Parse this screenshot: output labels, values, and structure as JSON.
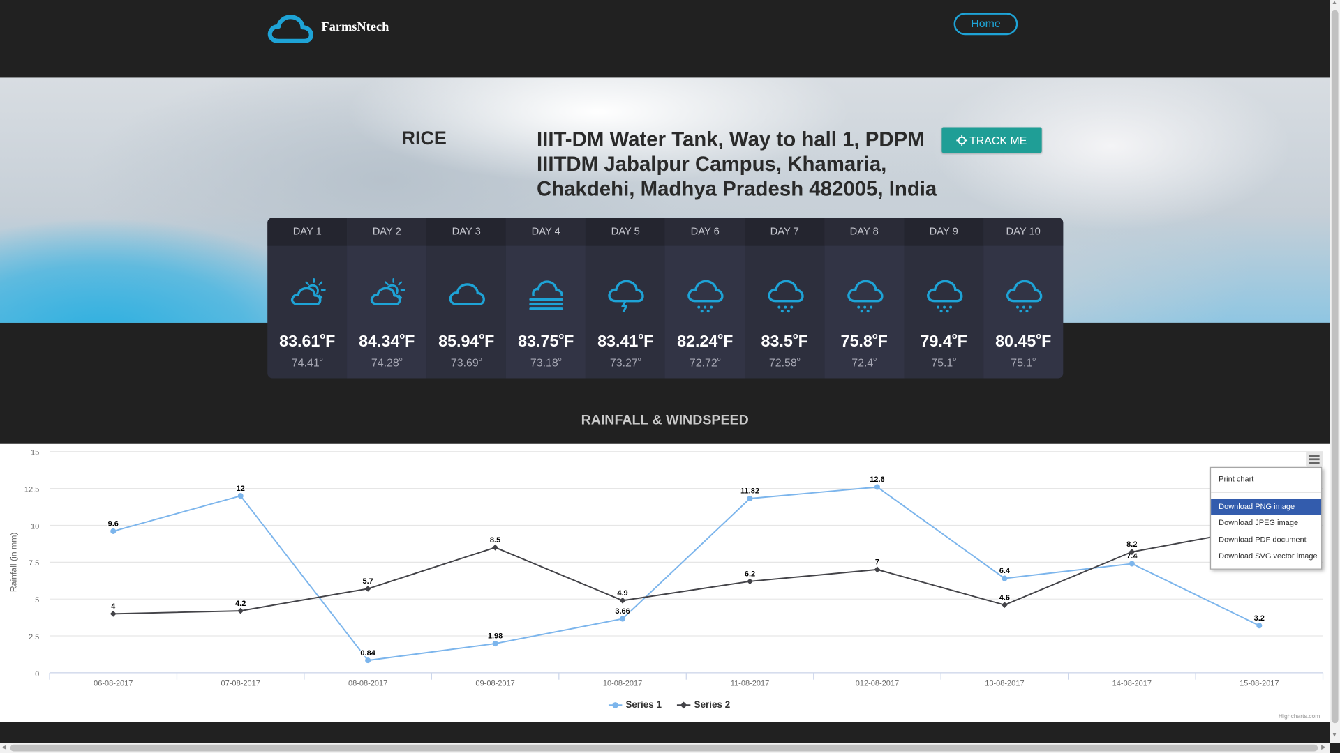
{
  "app": {
    "brand": "FarmsNtech",
    "nav_home": "Home"
  },
  "location": {
    "crop": "RICE",
    "address": "IIIT-DM Water Tank, Way to hall 1, PDPM IIITDM Jabalpur Campus, Khamaria, Chakdehi, Madhya Pradesh 482005, India",
    "track_label": "TRACK ME"
  },
  "forecast": [
    {
      "day": "DAY 1",
      "icon": "partly-sunny-icon",
      "max": "83.61",
      "unit": "F",
      "min": "74.41"
    },
    {
      "day": "DAY 2",
      "icon": "partly-sunny-icon",
      "max": "84.34",
      "unit": "F",
      "min": "74.28"
    },
    {
      "day": "DAY 3",
      "icon": "cloud-icon",
      "max": "85.94",
      "unit": "F",
      "min": "73.69"
    },
    {
      "day": "DAY 4",
      "icon": "fog-icon",
      "max": "83.75",
      "unit": "F",
      "min": "73.18"
    },
    {
      "day": "DAY 5",
      "icon": "thunderstorm-icon",
      "max": "83.41",
      "unit": "F",
      "min": "73.27"
    },
    {
      "day": "DAY 6",
      "icon": "snow-icon",
      "max": "82.24",
      "unit": "F",
      "min": "72.72"
    },
    {
      "day": "DAY 7",
      "icon": "snow-icon",
      "max": "83.5",
      "unit": "F",
      "min": "72.58"
    },
    {
      "day": "DAY 8",
      "icon": "snow-icon",
      "max": "75.8",
      "unit": "F",
      "min": "72.4"
    },
    {
      "day": "DAY 9",
      "icon": "snow-icon",
      "max": "79.4",
      "unit": "F",
      "min": "75.1"
    },
    {
      "day": "DAY 10",
      "icon": "snow-icon",
      "max": "80.45",
      "unit": "F",
      "min": "75.1"
    }
  ],
  "section_title": "RAINFALL & WINDSPEED",
  "export_menu": {
    "items": [
      "Print chart",
      "Download PNG image",
      "Download JPEG image",
      "Download PDF document",
      "Download SVG vector image"
    ],
    "highlighted": "Download PNG image"
  },
  "credits": "Highcharts.com",
  "colors": {
    "series1": "#7cb5ec",
    "series2": "#434348",
    "accent": "#1ea3d6",
    "track_button": "#1f9e96"
  },
  "chart_data": {
    "type": "line",
    "title": "",
    "xlabel": "",
    "ylabel": "Rainfall (in mm)",
    "ylim": [
      0,
      15
    ],
    "yticks": [
      "0",
      "2.5",
      "5",
      "7.5",
      "10",
      "12.5",
      "15"
    ],
    "categories": [
      "06-08-2017",
      "07-08-2017",
      "08-08-2017",
      "09-08-2017",
      "10-08-2017",
      "11-08-2017",
      "012-08-2017",
      "13-08-2017",
      "14-08-2017",
      "15-08-2017"
    ],
    "series": [
      {
        "name": "Series 1",
        "values": [
          9.6,
          12,
          0.84,
          1.98,
          3.66,
          11.82,
          12.6,
          6.4,
          7.4,
          3.2
        ],
        "labels": [
          "9.6",
          "12",
          "0.84",
          "1.98",
          "3.66",
          "11.82",
          "12.6",
          "6.4",
          "7.4",
          "3.2"
        ]
      },
      {
        "name": "Series 2",
        "values": [
          4,
          4.2,
          5.7,
          8.5,
          4.9,
          6.2,
          7,
          4.6,
          8.2,
          9.8
        ],
        "labels": [
          "4",
          "4.2",
          "5.7",
          "8.5",
          "4.9",
          "6.2",
          "7",
          "4.6",
          "8.2",
          ""
        ]
      }
    ],
    "grid": true,
    "legend": "bottom-center"
  }
}
